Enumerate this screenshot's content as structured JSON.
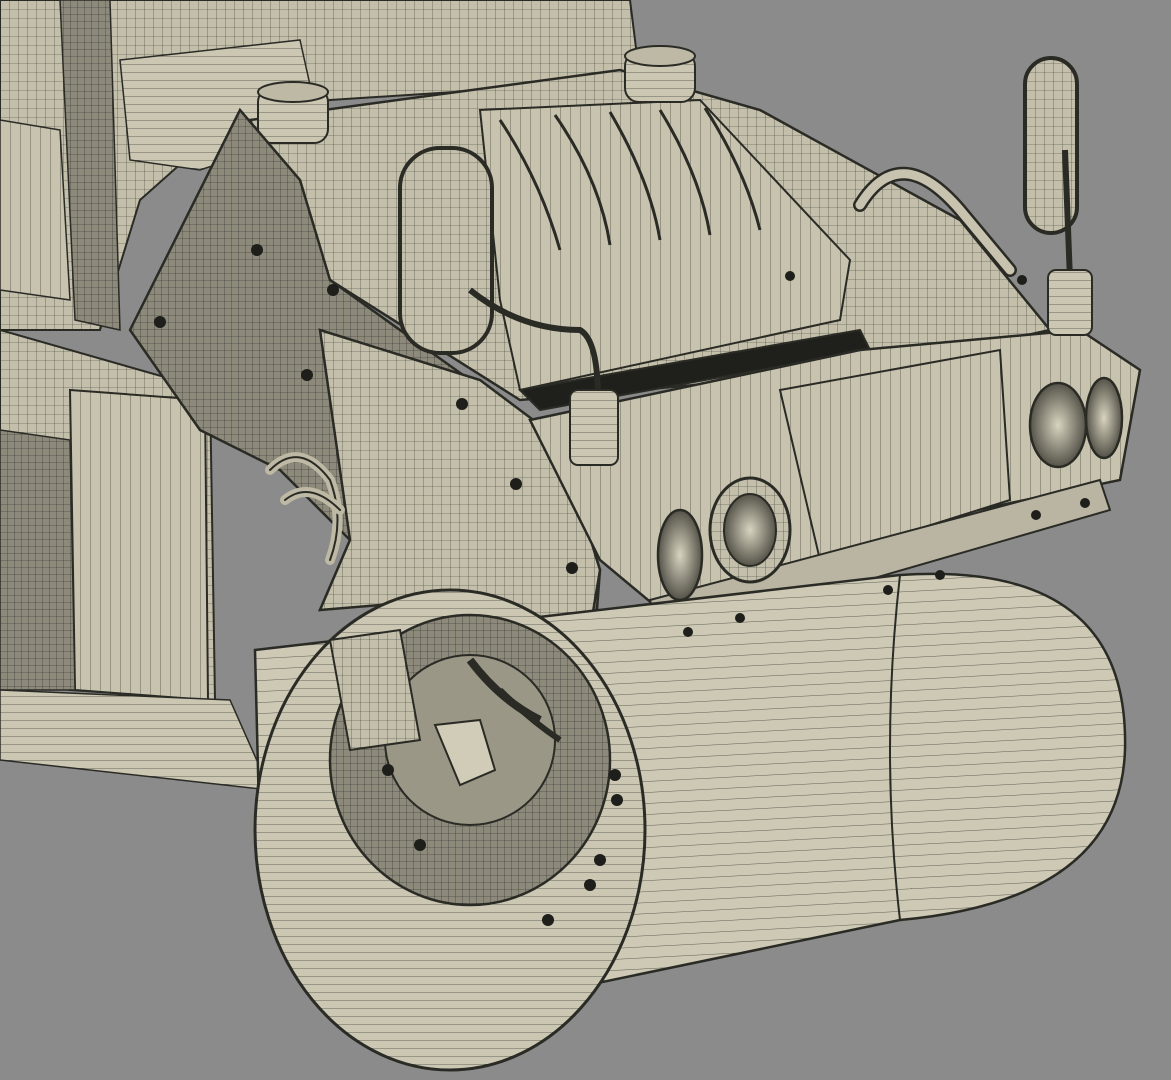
{
  "viewport": {
    "subject": "wireframe-render-road-roller",
    "colors": {
      "background": "#8b8b8b",
      "surface": "#cfcbb8",
      "surface_shade": "#b9b5a2",
      "surface_dark": "#6f6d62",
      "wire": "#2b2b26",
      "wire_light": "#4a4a42"
    }
  }
}
